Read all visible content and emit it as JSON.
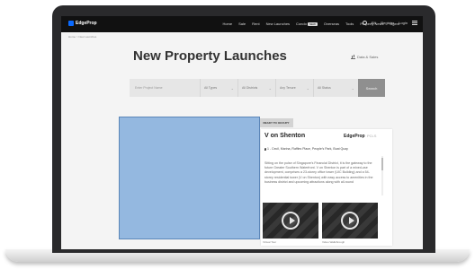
{
  "nav": {
    "logo": "EdgeProp",
    "links": [
      "Home",
      "Sale",
      "Rent",
      "New Launches",
      "Condo",
      "Overseas",
      "Tools",
      "Property News",
      "Agent"
    ],
    "condo_badge": "NEW",
    "lang": "EN",
    "register": "Register",
    "login": "Login"
  },
  "breadcrumb": "Home > New Launches",
  "page": {
    "title": "New Property Launches",
    "data_link": "Data & Sales"
  },
  "search": {
    "placeholder": "Enter Project Name",
    "types": "All Types",
    "districts": "All Districts",
    "tenure": "Any Tenure",
    "status": "All Status",
    "button": "Search"
  },
  "listing": {
    "tag": "READY TO OCCUPY",
    "name": "V on Shenton",
    "logo_text": "EdgeProp",
    "logo_sub": "PCLS",
    "address": "1 - Cecil, Marina, Raffles Place, People's Park, Boat Quay",
    "description": "Sitting on the pulse of Singapore's Financial District, it is the gateway to the future Greater Southern Waterfront. V on Shenton is part of a mixed-use development, comprises a 23-storey office tower (UIC Building) and a 54-storey residential tower (V on Shenton) with easy access to amenities in the business district and upcoming attractions along with all-round",
    "videos": [
      {
        "label": "Virtual Tour"
      },
      {
        "label": "Video Walkthrough"
      }
    ]
  },
  "colors": {
    "nav_bg": "#111111",
    "placeholder_block": "#94b8e0",
    "search_button": "#8f8f8f"
  }
}
